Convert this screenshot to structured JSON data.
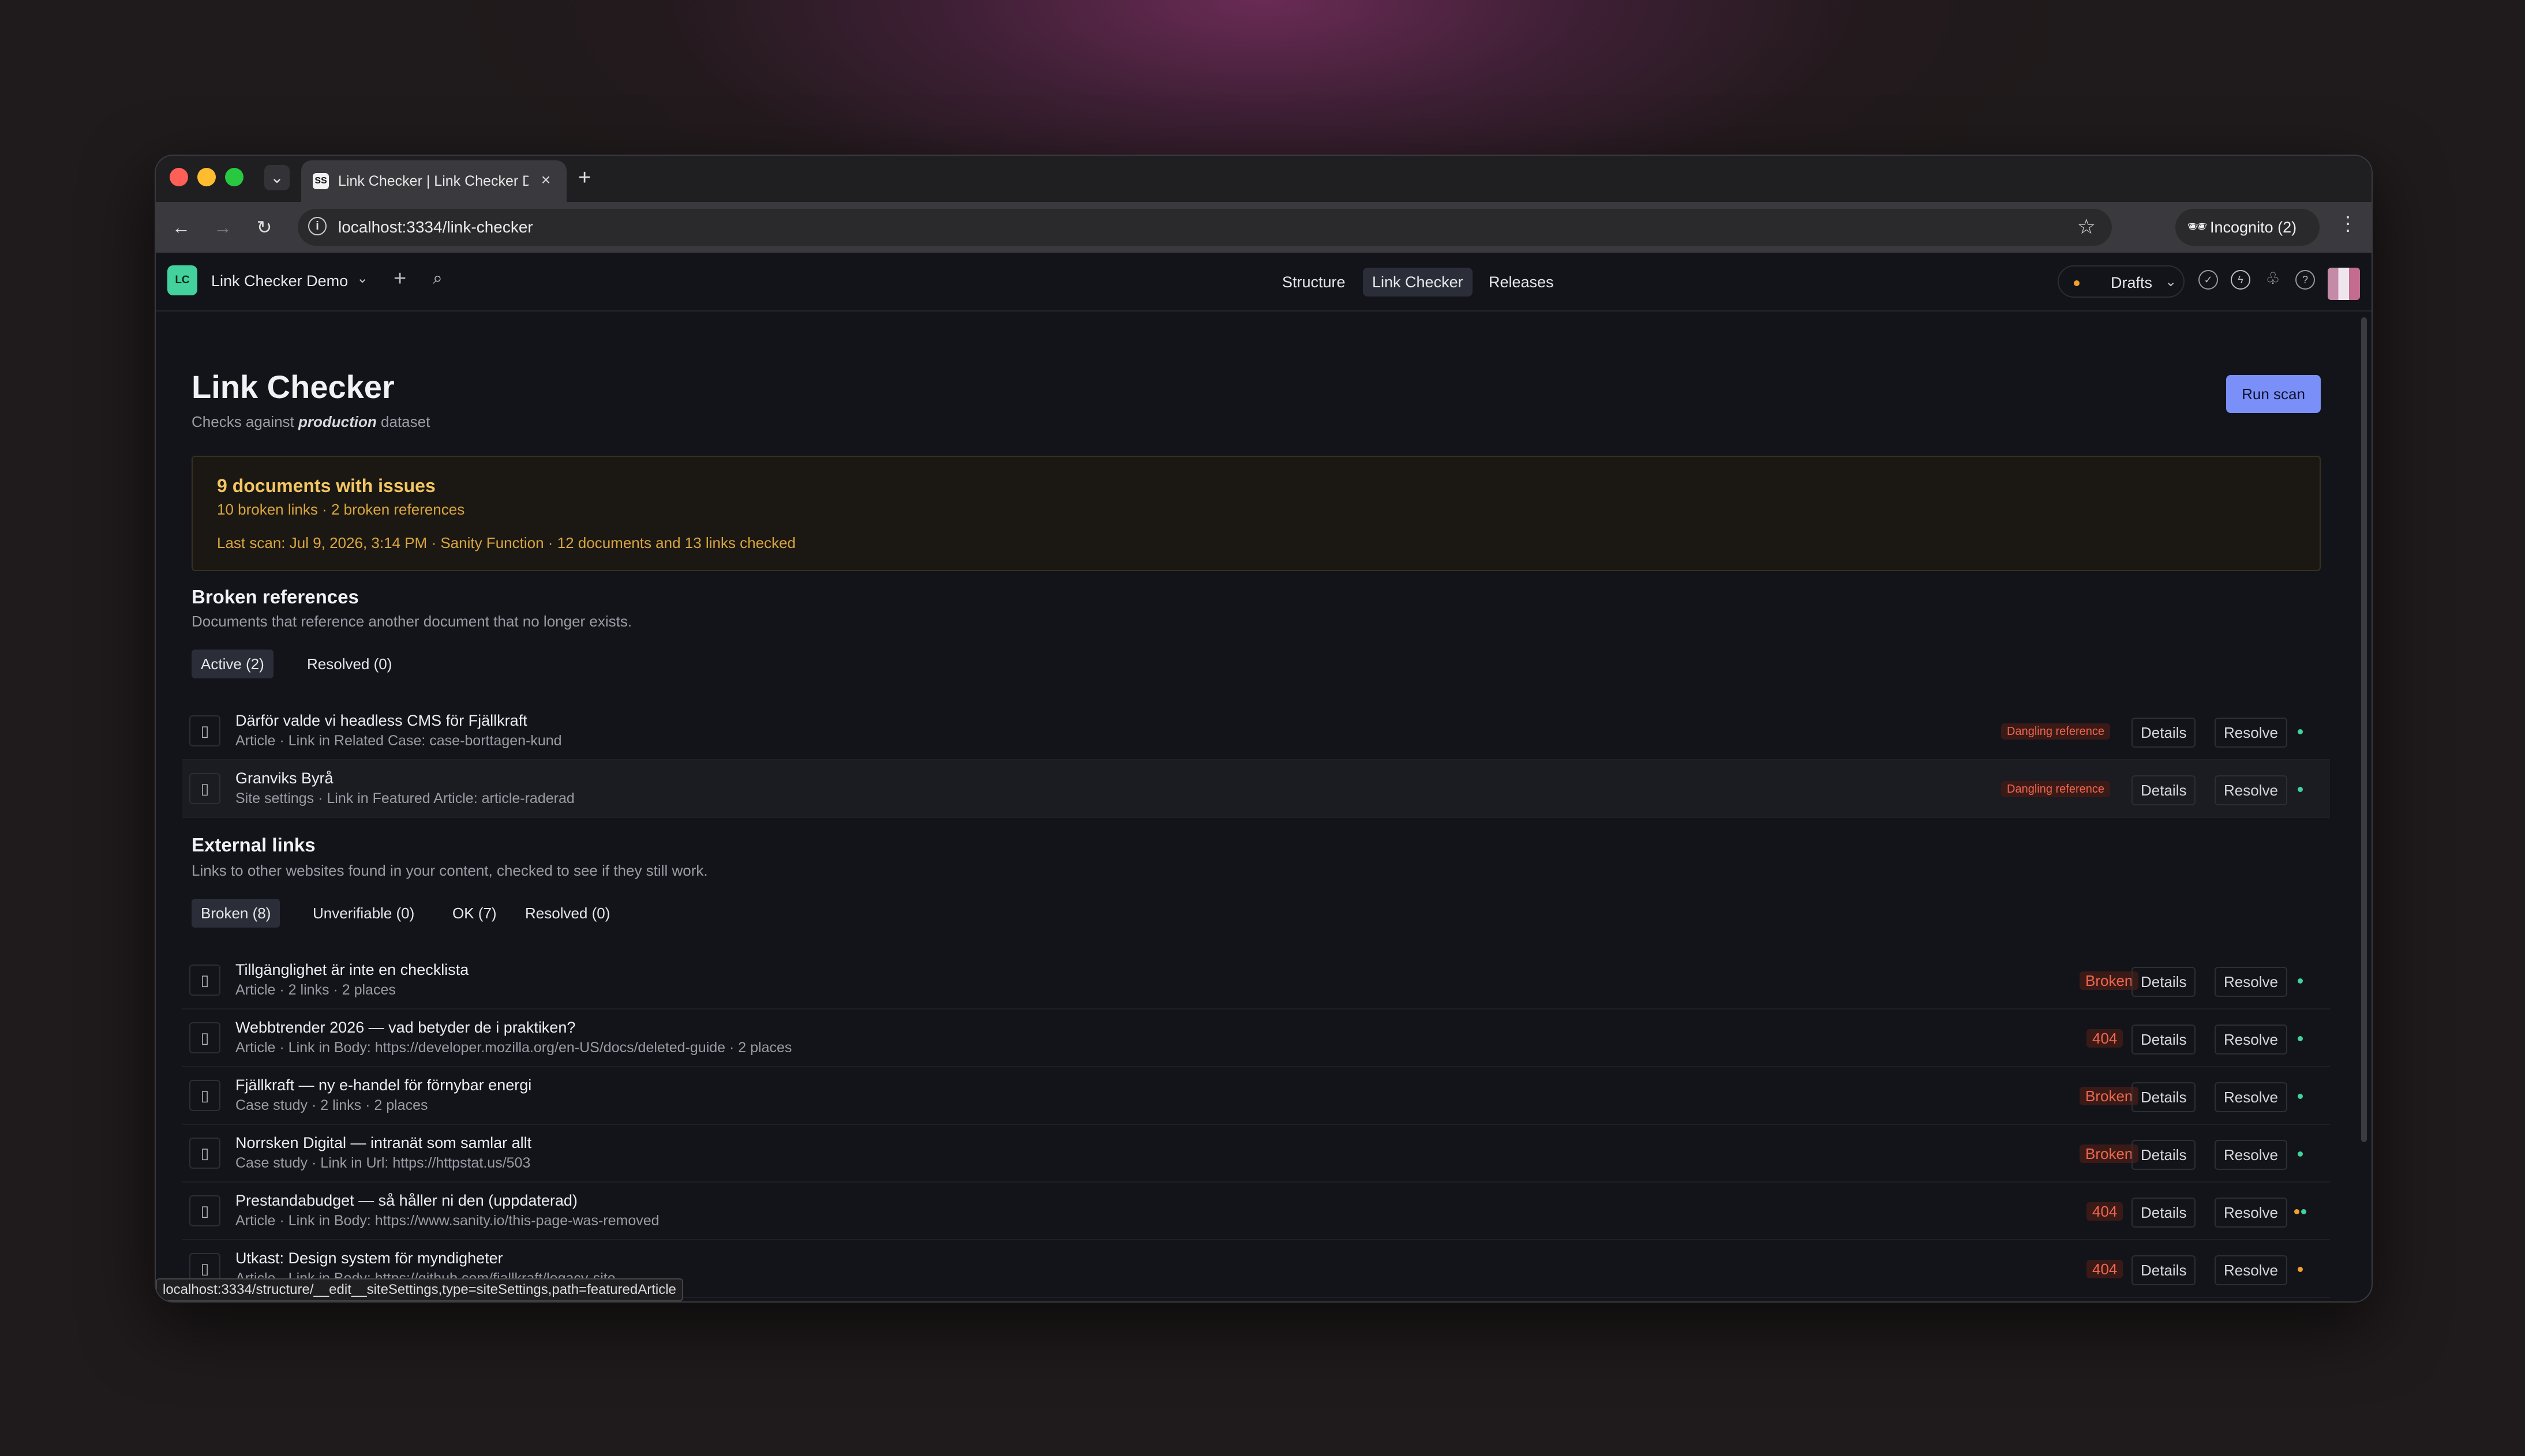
{
  "browser": {
    "tab_title": "Link Checker | Link Checker D",
    "tab_favicon": "SS",
    "url": "localhost:3334/link-checker",
    "incognito_label": "Incognito (2)",
    "status_url": "localhost:3334/structure/__edit__siteSettings,type=siteSettings,path=featuredArticle"
  },
  "app": {
    "workspace_logo": "LC",
    "workspace_name": "Link Checker Demo",
    "nav": [
      "Structure",
      "Link Checker",
      "Releases"
    ],
    "active_nav": "Link Checker",
    "perspective": "Drafts"
  },
  "page": {
    "title": "Link Checker",
    "subtitle_prefix": "Checks against",
    "dataset": "production",
    "subtitle_suffix": "dataset",
    "run_scan": "Run scan"
  },
  "summary": {
    "title": "9 documents with issues",
    "counts": "10 broken links · 2 broken references",
    "last_scan": "Last scan: Jul 9, 2026, 3:14 PM · Sanity Function · 12 documents and 13 links checked"
  },
  "broken_refs": {
    "title": "Broken references",
    "description": "Documents that reference another document that no longer exists.",
    "tabs": [
      "Active (2)",
      "Resolved (0)"
    ],
    "rows": [
      {
        "title": "Därför valde vi headless CMS för Fjällkraft",
        "meta": "Article · Link in Related Case: case-borttagen-kund",
        "badge": "Dangling reference",
        "details": "Details",
        "resolve": "Resolve"
      },
      {
        "title": "Granviks Byrå",
        "meta": "Site settings · Link in Featured Article: article-raderad",
        "badge": "Dangling reference",
        "details": "Details",
        "resolve": "Resolve"
      }
    ]
  },
  "external": {
    "title": "External links",
    "description": "Links to other websites found in your content, checked to see if they still work.",
    "tabs": [
      "Broken (8)",
      "Unverifiable (0)",
      "OK (7)",
      "Resolved (0)"
    ],
    "rows": [
      {
        "title": "Tillgänglighet är inte en checklista",
        "meta": "Article · 2 links · 2 places",
        "badge": "Broken",
        "details": "Details",
        "resolve": "Resolve"
      },
      {
        "title": "Webbtrender 2026 — vad betyder de i praktiken?",
        "meta": "Article · Link in Body: https://developer.mozilla.org/en-US/docs/deleted-guide · 2 places",
        "badge": "404",
        "details": "Details",
        "resolve": "Resolve"
      },
      {
        "title": "Fjällkraft — ny e-handel för förnybar energi",
        "meta": "Case study · 2 links · 2 places",
        "badge": "Broken",
        "details": "Details",
        "resolve": "Resolve"
      },
      {
        "title": "Norrsken Digital — intranät som samlar allt",
        "meta": "Case study · Link in Url: https://httpstat.us/503",
        "badge": "Broken",
        "details": "Details",
        "resolve": "Resolve"
      },
      {
        "title": "Prestandabudget — så håller ni den (uppdaterad)",
        "meta": "Article · Link in Body: https://www.sanity.io/this-page-was-removed",
        "badge": "404",
        "details": "Details",
        "resolve": "Resolve"
      },
      {
        "title": "Utkast: Design system för myndigheter",
        "meta": "Article · Link in Body: https://github.com/fjallkraft/legacy-site",
        "badge": "404",
        "details": "Details",
        "resolve": "Resolve"
      }
    ]
  },
  "colors": {
    "accent": "#7a8ff7",
    "published": "#43d29d",
    "draft": "#f0a12c",
    "error": "#f0664f"
  }
}
